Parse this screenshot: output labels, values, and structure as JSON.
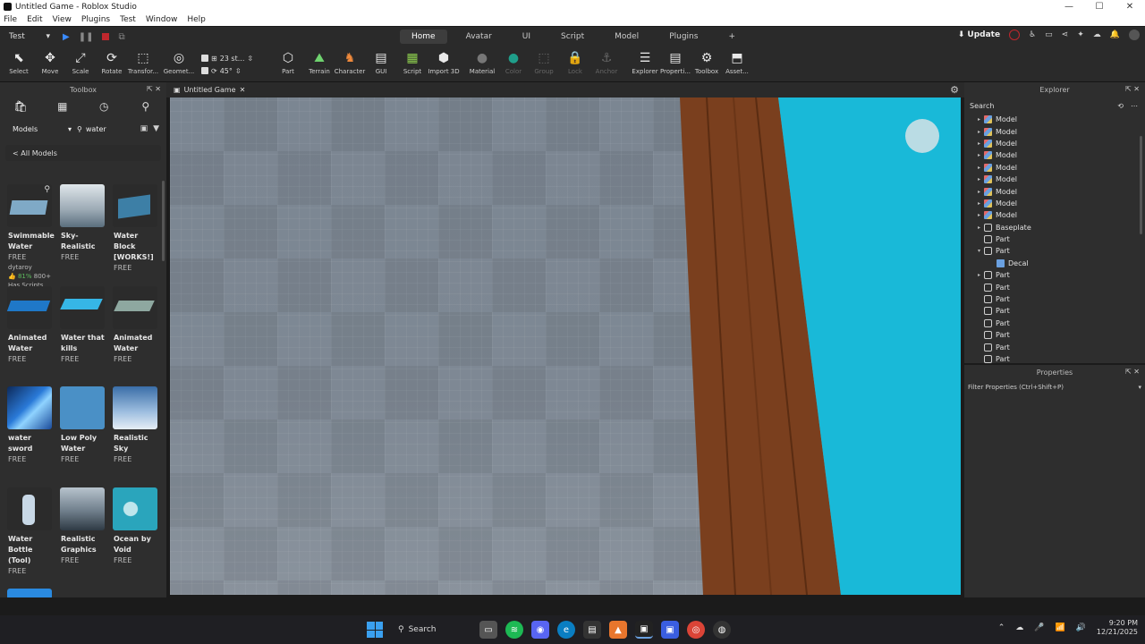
{
  "window": {
    "title": "Untitled Game - Roblox Studio",
    "controls": [
      "—",
      "☐",
      "✕"
    ]
  },
  "menu": [
    "File",
    "Edit",
    "View",
    "Plugins",
    "Test",
    "Window",
    "Help"
  ],
  "mode_select": "Test",
  "ribbon_tabs": [
    "Home",
    "Avatar",
    "UI",
    "Script",
    "Model",
    "Plugins",
    "+"
  ],
  "active_tab": "Home",
  "update_label": "Update",
  "tools": [
    {
      "label": "Select",
      "icon": "cursor-icon",
      "glyph": "⬉"
    },
    {
      "label": "Move",
      "icon": "move-icon",
      "glyph": "✥"
    },
    {
      "label": "Scale",
      "icon": "scale-icon",
      "glyph": "⤢"
    },
    {
      "label": "Rotate",
      "icon": "rotate-icon",
      "glyph": "⟳"
    },
    {
      "label": "Transfor...",
      "icon": "transform-icon",
      "glyph": "⬚"
    },
    {
      "label": "Geomet...",
      "icon": "geometry-icon",
      "glyph": "◎"
    }
  ],
  "snap": {
    "move_value": "23 st...",
    "rotate_value": "45°"
  },
  "tools2": [
    {
      "label": "Part",
      "icon": "part-icon",
      "glyph": "⬡"
    },
    {
      "label": "Terrain",
      "icon": "terrain-icon",
      "glyph": "⛰"
    },
    {
      "label": "Character",
      "icon": "character-icon",
      "glyph": "♞"
    },
    {
      "label": "GUI",
      "icon": "gui-icon",
      "glyph": "▤"
    },
    {
      "label": "Script",
      "icon": "script-icon",
      "glyph": "▦"
    },
    {
      "label": "Import 3D",
      "icon": "import-3d-icon",
      "glyph": "⬢"
    },
    {
      "label": "Material",
      "icon": "material-icon",
      "glyph": "●"
    },
    {
      "label": "Color",
      "icon": "color-icon",
      "glyph": "●"
    },
    {
      "label": "Group",
      "icon": "group-icon",
      "glyph": "⬚"
    },
    {
      "label": "Lock",
      "icon": "lock-icon",
      "glyph": "🔒"
    },
    {
      "label": "Anchor",
      "icon": "anchor-icon",
      "glyph": "⚓"
    },
    {
      "label": "Explorer",
      "icon": "explorer-icon",
      "glyph": "☰"
    },
    {
      "label": "Properti...",
      "icon": "properties-icon",
      "glyph": "▤"
    },
    {
      "label": "Toolbox",
      "icon": "toolbox-icon",
      "glyph": "⚙"
    },
    {
      "label": "Asset...",
      "icon": "asset-manager-icon",
      "glyph": "⬒"
    }
  ],
  "toolbox": {
    "title": "Toolbox",
    "category": "Models",
    "query": "water",
    "all_models": "< All Models",
    "items": [
      {
        "name": "Swimmable Water",
        "price": "FREE",
        "creator": "dytaroy",
        "rating": "81%",
        "votes": "800+",
        "note": "Has Scripts",
        "color": "#7fa9c6"
      },
      {
        "name": "Sky-Realistic",
        "price": "FREE",
        "color": "#c9d6e0"
      },
      {
        "name": "Water Block [WORKS!]",
        "price": "FREE",
        "color": "#3d7fa6"
      },
      {
        "name": "Animated Water",
        "price": "FREE",
        "color": "#1f78c8"
      },
      {
        "name": "Water that kills",
        "price": "FREE",
        "color": "#36b6e6"
      },
      {
        "name": "Animated Water",
        "price": "FREE",
        "color": "#8ea8a0"
      },
      {
        "name": "water sword",
        "price": "FREE",
        "color": "#2a7ad8"
      },
      {
        "name": "Low Poly Water",
        "price": "FREE",
        "color": "#4a90c6"
      },
      {
        "name": "Realistic Sky",
        "price": "FREE",
        "color": "#5d86b8"
      },
      {
        "name": "Water Bottle (Tool)",
        "price": "FREE",
        "color": "#c8d8e6"
      },
      {
        "name": "Realistic Graphics",
        "price": "FREE",
        "color": "#7f8e9c"
      },
      {
        "name": "Ocean by Void",
        "price": "FREE",
        "color": "#2aa5bc"
      }
    ]
  },
  "document_tab": "Untitled Game",
  "explorer": {
    "title": "Explorer",
    "search_placeholder": "Search",
    "items": [
      {
        "name": "Model",
        "type": "model",
        "arrow": "▸",
        "indent": 0
      },
      {
        "name": "Model",
        "type": "model",
        "arrow": "▸",
        "indent": 0
      },
      {
        "name": "Model",
        "type": "model",
        "arrow": "▸",
        "indent": 0
      },
      {
        "name": "Model",
        "type": "model",
        "arrow": "▸",
        "indent": 0
      },
      {
        "name": "Model",
        "type": "model",
        "arrow": "▸",
        "indent": 0
      },
      {
        "name": "Model",
        "type": "model",
        "arrow": "▸",
        "indent": 0
      },
      {
        "name": "Model",
        "type": "model",
        "arrow": "▸",
        "indent": 0
      },
      {
        "name": "Model",
        "type": "model",
        "arrow": "▸",
        "indent": 0
      },
      {
        "name": "Model",
        "type": "model",
        "arrow": "▸",
        "indent": 0
      },
      {
        "name": "Baseplate",
        "type": "baseplate",
        "arrow": "▸",
        "indent": 0
      },
      {
        "name": "Part",
        "type": "part",
        "arrow": "",
        "indent": 0
      },
      {
        "name": "Part",
        "type": "part",
        "arrow": "▾",
        "indent": 0
      },
      {
        "name": "Decal",
        "type": "decal",
        "arrow": "",
        "indent": 1
      },
      {
        "name": "Part",
        "type": "part",
        "arrow": "▸",
        "indent": 0
      },
      {
        "name": "Part",
        "type": "part",
        "arrow": "",
        "indent": 0
      },
      {
        "name": "Part",
        "type": "part",
        "arrow": "",
        "indent": 0
      },
      {
        "name": "Part",
        "type": "part",
        "arrow": "",
        "indent": 0
      },
      {
        "name": "Part",
        "type": "part",
        "arrow": "",
        "indent": 0
      },
      {
        "name": "Part",
        "type": "part",
        "arrow": "",
        "indent": 0
      },
      {
        "name": "Part",
        "type": "part",
        "arrow": "",
        "indent": 0
      },
      {
        "name": "Part",
        "type": "part",
        "arrow": "",
        "indent": 0
      }
    ]
  },
  "properties": {
    "title": "Properties",
    "filter_placeholder": "Filter Properties (Ctrl+Shift+P)"
  },
  "taskbar": {
    "search_label": "Search",
    "time": "9:20 PM",
    "date": "12/21/2025"
  },
  "colors": {
    "water": "#19b9d8",
    "wood": "#8a4a25",
    "floor": "#7f8a95",
    "accent": "#3a8bff"
  }
}
